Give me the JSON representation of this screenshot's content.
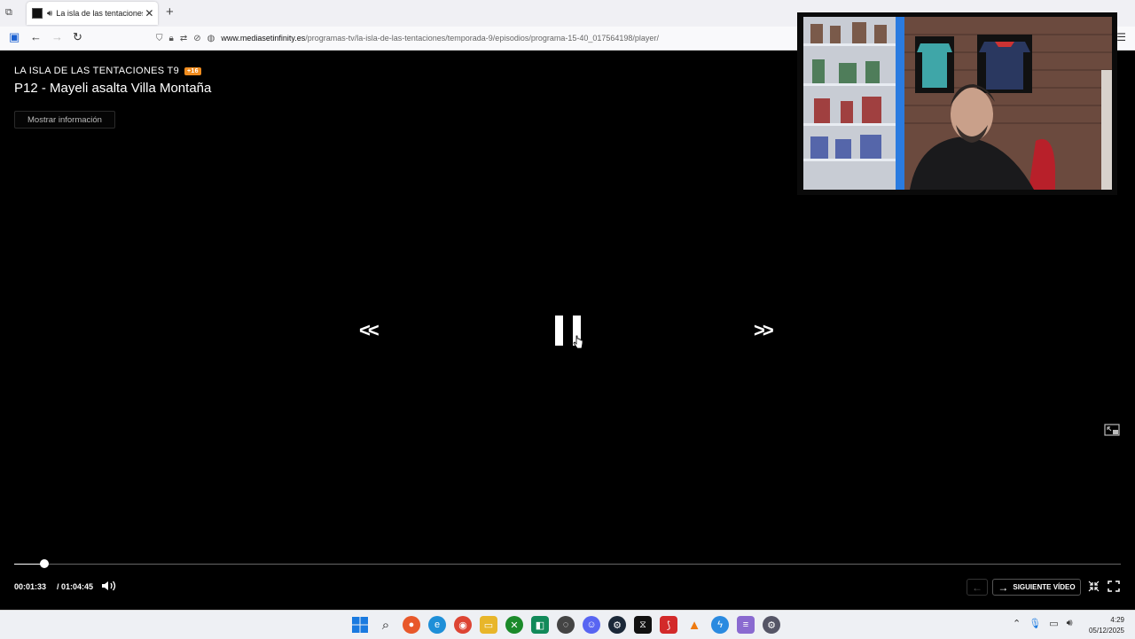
{
  "browser": {
    "tab_title": "La isla de las tentaciones: P",
    "url_host": "www.mediasetinfinity.es",
    "url_path": "/programas-tv/la-isla-de-las-tentaciones/temporada-9/episodios/programa-15-40_017564198/player/"
  },
  "player": {
    "show_title": "LA ISLA DE LAS TENTACIONES T9",
    "age_rating": "+16",
    "episode_title": "P12 - Mayeli asalta Villa Montaña",
    "info_button": "Mostrar información",
    "rewind_glyph": "<<",
    "forward_glyph": ">>",
    "current_time": "00:01:33",
    "total_time": "/ 01:04:45",
    "progress_fraction": 0.0273,
    "next_video_label": "SIGUIENTE VÍDEO"
  },
  "taskbar": {
    "icons": [
      "windows-start",
      "search",
      "firefox",
      "edge",
      "chrome",
      "file-explorer",
      "xbox",
      "android-studio",
      "obs",
      "discord",
      "steam",
      "capcut",
      "pdf-reader",
      "vlc",
      "messenger",
      "notepad",
      "settings"
    ],
    "time": "4:29",
    "date": "05/12/2025"
  },
  "colors": {
    "accent_badge": "#f08c1e",
    "taskbar": "#eef0f4"
  }
}
